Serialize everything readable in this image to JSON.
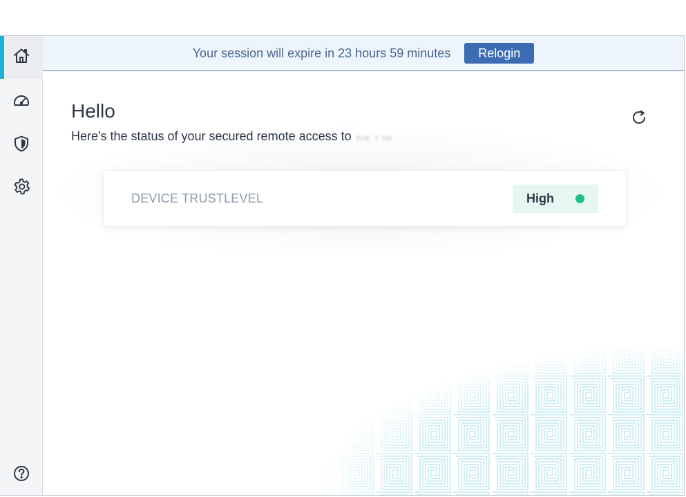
{
  "banner": {
    "message": "Your session will expire in 23 hours 59 minutes",
    "relogin_label": "Relogin"
  },
  "sidebar": {
    "items": [
      {
        "icon": "home-icon",
        "active": true
      },
      {
        "icon": "dashboard-gauge-icon",
        "active": false
      },
      {
        "icon": "shield-icon",
        "active": false
      },
      {
        "icon": "gear-icon",
        "active": false
      },
      {
        "icon": "help-icon",
        "active": false
      }
    ]
  },
  "main": {
    "greeting": "Hello",
    "status_text": "Here's the status of your secured remote access to",
    "host_redacted": "tud: c tar"
  },
  "trust_card": {
    "label": "DEVICE TRUSTLEVEL",
    "value": "High",
    "status_color": "#1ec28a"
  },
  "colors": {
    "accent": "#19b3d8",
    "button": "#3c6cb4",
    "banner_bg": "#eef4fc"
  }
}
